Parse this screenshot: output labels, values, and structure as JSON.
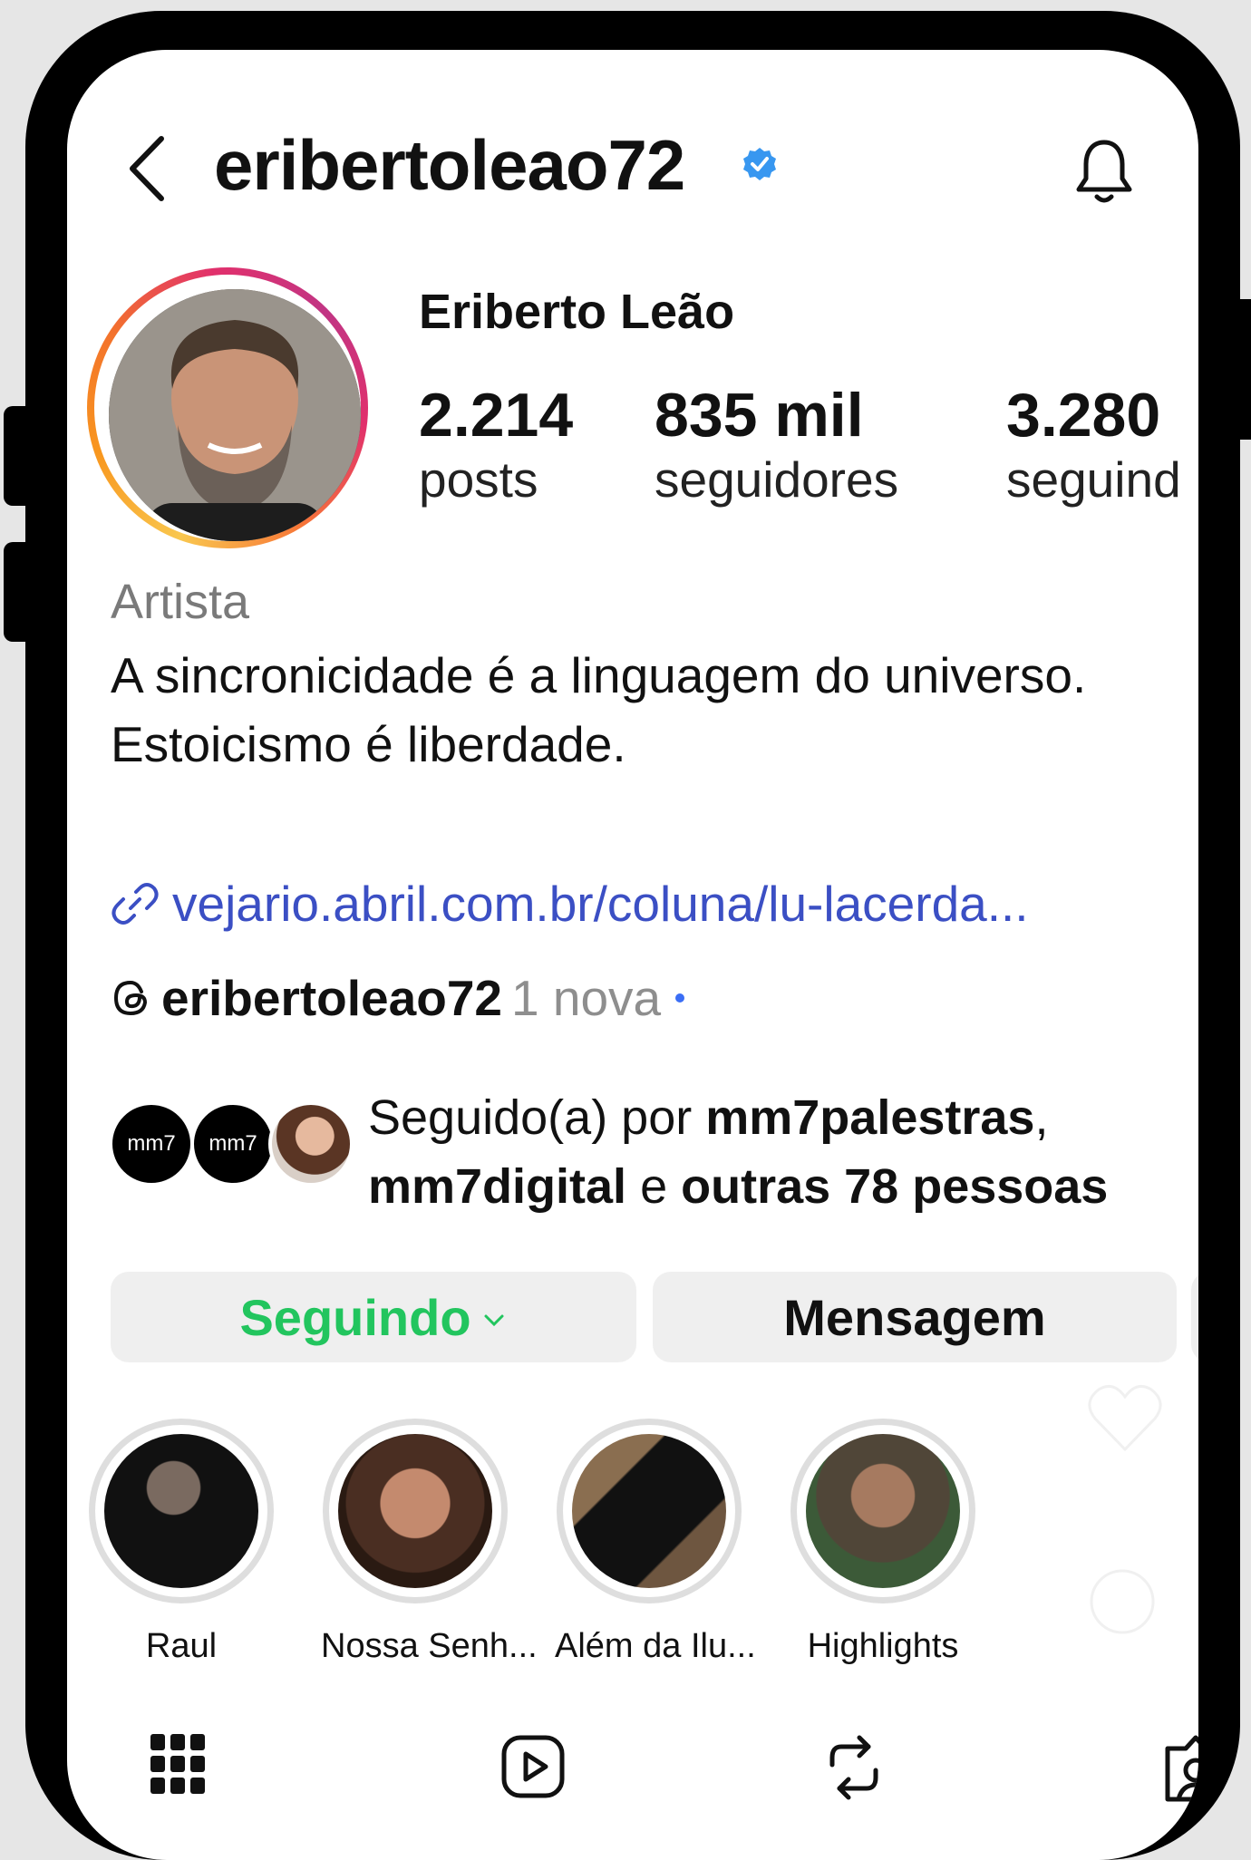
{
  "header": {
    "username": "eribertoleao72",
    "verified": true,
    "back_icon": "chevron-left-icon",
    "bell_icon": "bell-icon"
  },
  "profile": {
    "full_name": "Eriberto Leão",
    "stats": [
      {
        "number": "2.214",
        "label": "posts"
      },
      {
        "number": "835 mil",
        "label": "seguidores"
      },
      {
        "number": "3.280",
        "label": "seguind"
      }
    ],
    "category": "Artista",
    "bio_line1": "A sincronicidade é a linguagem do universo.",
    "bio_line2": "Estoicismo é liberdade.",
    "link": "vejario.abril.com.br/coluna/lu-lacerda...",
    "threads_handle": "eribertoleao72",
    "threads_new": "1 nova"
  },
  "followed_by": {
    "prefix": "Seguido(a) por ",
    "user1": "mm7palestras",
    "sep": ",",
    "user2": "mm7digital",
    "conj": " e ",
    "others": "outras 78 pessoas",
    "avatar1_text": "mm7",
    "avatar2_text": "mm7"
  },
  "buttons": {
    "following": "Seguindo",
    "message": "Mensagem"
  },
  "highlights": [
    {
      "label": "Raul"
    },
    {
      "label": "Nossa Senh..."
    },
    {
      "label": "Além da Ilu..."
    },
    {
      "label": "Highlights"
    }
  ],
  "tabs": [
    "grid-icon",
    "reels-icon",
    "reposts-icon",
    "tagged-icon"
  ],
  "colors": {
    "following": "#22c55e",
    "link": "#3b4fc4",
    "verified": "#3897f0"
  }
}
